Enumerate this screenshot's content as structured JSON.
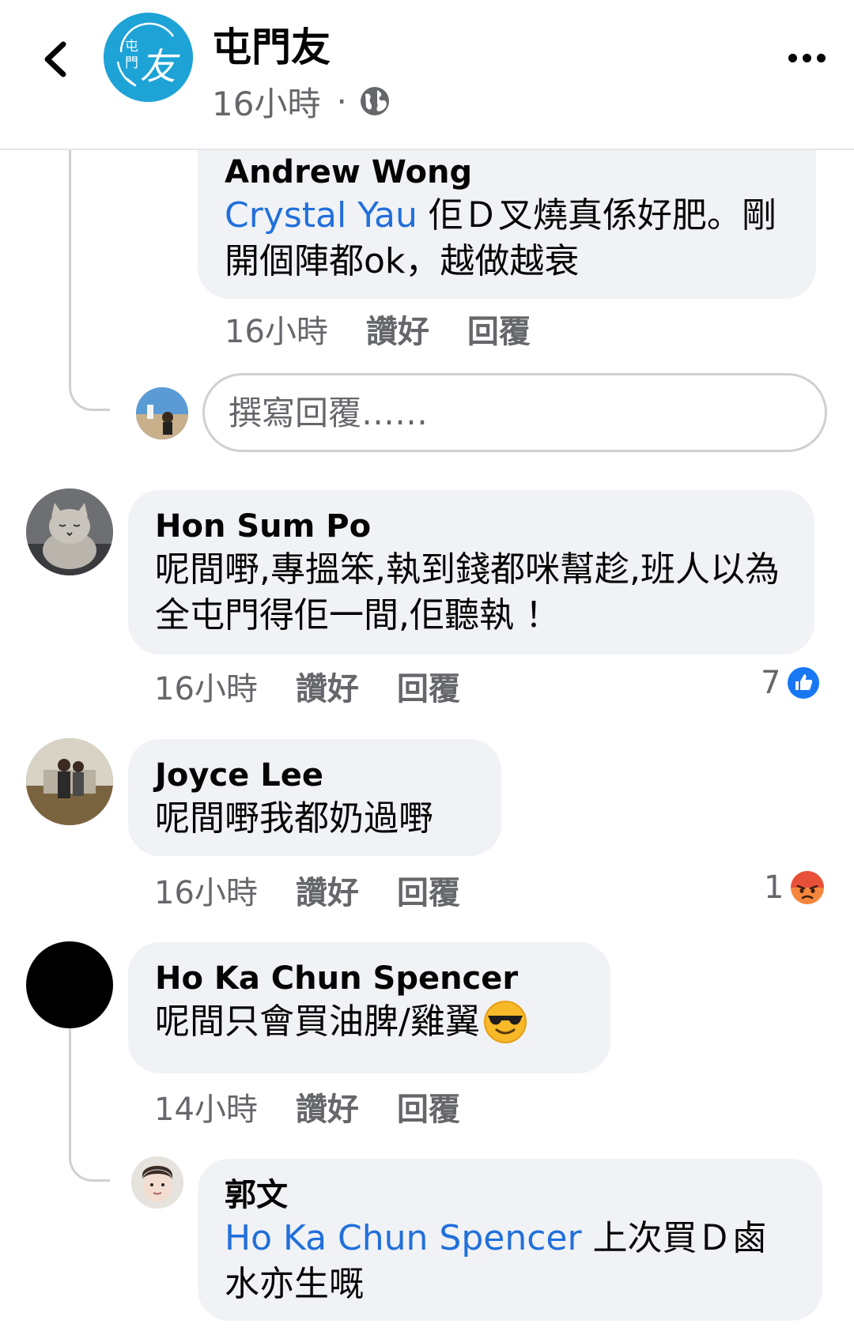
{
  "header": {
    "page_name": "屯門友",
    "post_time": "16小時",
    "dot": "·",
    "logo_text": "屯門友"
  },
  "comments": [
    {
      "author": "Andrew Wong",
      "mention": "Crystal Yau",
      "text": " 佢Ｄ叉燒真係好肥。剛開個陣都ok，越做越衰",
      "time": "16小時",
      "like_label": "讚好",
      "reply_label": "回覆"
    },
    {
      "author": "Hon Sum Po",
      "text": "呢間嘢,專搵笨,執到錢都咪幫趁,班人以為全屯門得佢一間,佢聽執 ！",
      "time": "16小時",
      "like_label": "讚好",
      "reply_label": "回覆",
      "reaction_count": "7"
    },
    {
      "author": "Joyce Lee",
      "text": "呢間嘢我都奶過嘢",
      "time": "16小時",
      "like_label": "讚好",
      "reply_label": "回覆",
      "reaction_count": "1"
    },
    {
      "author": "Ho Ka Chun Spencer",
      "text": "呢間只會買油脾/雞翼",
      "time": "14小時",
      "like_label": "讚好",
      "reply_label": "回覆"
    },
    {
      "author": "郭文",
      "mention": "Ho Ka Chun Spencer",
      "text": " 上次買Ｄ鹵水亦生嘅"
    }
  ],
  "reply_box": {
    "placeholder": "撰寫回覆……"
  },
  "icons": {
    "back": "chevron-left-icon",
    "more": "more-dots-icon",
    "audience": "globe-icon",
    "like_reaction": "like-reaction-icon",
    "angry_reaction": "angry-reaction-icon",
    "emoji": "sunglasses-emoji-icon"
  },
  "colors": {
    "mention": "#216fdb",
    "bubble": "#f0f2f5",
    "secondary_text": "#65676b",
    "like_blue": "#1877f2",
    "angry_orange": "#f5863d",
    "page_avatar": "#1ea3d7"
  }
}
